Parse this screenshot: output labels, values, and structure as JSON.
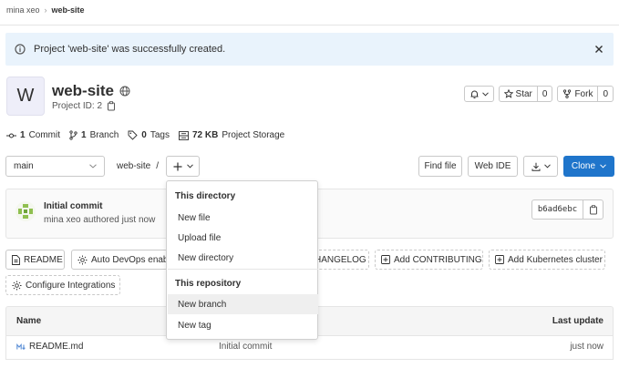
{
  "breadcrumb": {
    "parent": "mina xeo",
    "current": "web-site"
  },
  "alert": {
    "text": "Project 'web-site' was successfully created."
  },
  "project": {
    "avatar_letter": "W",
    "name": "web-site",
    "id_label": "Project ID: 2"
  },
  "header_buttons": {
    "star_label": "Star",
    "star_count": "0",
    "fork_label": "Fork",
    "fork_count": "0"
  },
  "stats": {
    "commits_num": "1",
    "commits_label": "Commit",
    "branches_num": "1",
    "branches_label": "Branch",
    "tags_num": "0",
    "tags_label": "Tags",
    "storage_num": "72 KB",
    "storage_label": "Project Storage"
  },
  "toolbar": {
    "branch": "main",
    "path_root": "web-site",
    "path_sep": "/",
    "find_file": "Find file",
    "web_ide": "Web IDE",
    "clone": "Clone"
  },
  "last_commit": {
    "title": "Initial commit",
    "meta": "mina xeo authored just now",
    "sha": "b6ad6ebc"
  },
  "actions": {
    "readme": "README",
    "auto_devops": "Auto DevOps enab",
    "changelog": "HANGELOG",
    "add_contributing": "Add CONTRIBUTING",
    "add_k8s": "Add Kubernetes cluster",
    "configure_integrations": "Configure Integrations"
  },
  "table": {
    "headers": {
      "name": "Name",
      "last_update": "Last update"
    },
    "rows": [
      {
        "name": "README.md",
        "commit": "Initial commit",
        "updated": "just now"
      }
    ]
  },
  "dropdown": {
    "section1": "This directory",
    "items1": [
      "New file",
      "Upload file",
      "New directory"
    ],
    "section2": "This repository",
    "items2": [
      "New branch",
      "New tag"
    ]
  },
  "colors": {
    "primary": "#1f75cb",
    "alert_bg": "#e9f3fc",
    "avatar_bg": "#eeeef9"
  }
}
